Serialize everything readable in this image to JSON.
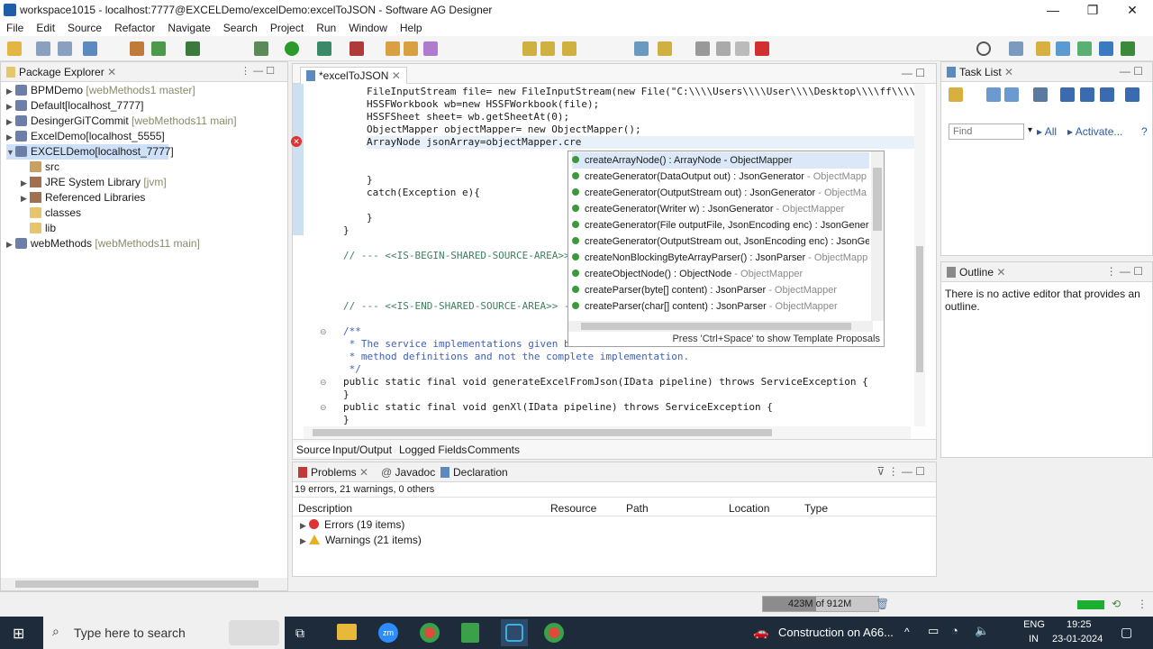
{
  "window": {
    "title": "workspace1015 - localhost:7777@EXCELDemo/excelDemo:excelToJSON - Software AG Designer",
    "min": "—",
    "max": "❐",
    "close": "✕"
  },
  "menu": [
    "File",
    "Edit",
    "Source",
    "Refactor",
    "Navigate",
    "Search",
    "Project",
    "Run",
    "Window",
    "Help"
  ],
  "package_explorer": {
    "tab": "Package Explorer",
    "items": [
      {
        "name": "BPMDemo",
        "extra": "[webMethods1 master]"
      },
      {
        "name": "Default[localhost_7777]",
        "extra": ""
      },
      {
        "name": "DesingerGiTCommit",
        "extra": "[webMethods11 main]"
      },
      {
        "name": "ExcelDemo[localhost_5555]",
        "extra": ""
      },
      {
        "name": "EXCELDemo[localhost_7777]",
        "extra": ""
      },
      {
        "name": "src",
        "extra": ""
      },
      {
        "name": "JRE System Library",
        "extra": "[jvm]"
      },
      {
        "name": "Referenced Libraries",
        "extra": ""
      },
      {
        "name": "classes",
        "extra": ""
      },
      {
        "name": "lib",
        "extra": ""
      },
      {
        "name": "webMethods",
        "extra": "[webMethods11 main]"
      }
    ]
  },
  "editor": {
    "tab": "*excelToJSON",
    "lines": [
      "FileInputStream file= new FileInputStream(new File(\"C:\\\\\\\\Users\\\\\\\\User\\\\\\\\Desktop\\\\\\\\ff\\\\\\\\",
      "HSSFWorkbook wb=new HSSFWorkbook(file);",
      "HSSFSheet sheet= wb.getSheetAt(0);",
      "ObjectMapper objectMapper= new ObjectMapper();",
      "ArrayNode jsonArray=objectMapper.cre",
      "}",
      "catch(Exception e){",
      "}",
      "}",
      "// --- <<IS-BEGIN-SHARED-SOURCE-AREA>> ---",
      "// --- <<IS-END-SHARED-SOURCE-AREA>> ---",
      "/**",
      " * The service implementations given b",
      " * method definitions and not the complete implementation.",
      " */",
      "public static final void generateExcelFromJson(IData pipeline) throws ServiceException {",
      "}",
      "public static final void genXl(IData pipeline) throws ServiceException {",
      "}"
    ],
    "bottom_tabs": [
      "Source",
      "Input/Output",
      "Logged Fields",
      "Comments"
    ]
  },
  "autocomplete": {
    "items": [
      {
        "sig": "createArrayNode() : ArrayNode",
        "owner": " - ObjectMapper"
      },
      {
        "sig": "createGenerator(DataOutput out) : JsonGenerator",
        "owner": " - ObjectMapp"
      },
      {
        "sig": "createGenerator(OutputStream out) : JsonGenerator",
        "owner": " - ObjectMa"
      },
      {
        "sig": "createGenerator(Writer w) : JsonGenerator",
        "owner": " - ObjectMapper"
      },
      {
        "sig": "createGenerator(File outputFile, JsonEncoding enc) : JsonGenera",
        "owner": ""
      },
      {
        "sig": "createGenerator(OutputStream out, JsonEncoding enc) : JsonGe",
        "owner": ""
      },
      {
        "sig": "createNonBlockingByteArrayParser() : JsonParser",
        "owner": " - ObjectMapp"
      },
      {
        "sig": "createObjectNode() : ObjectNode",
        "owner": " - ObjectMapper"
      },
      {
        "sig": "createParser(byte[] content) : JsonParser",
        "owner": " - ObjectMapper"
      },
      {
        "sig": "createParser(char[] content) : JsonParser",
        "owner": " - ObjectMapper"
      }
    ],
    "hint": "Press 'Ctrl+Space' to show Template Proposals"
  },
  "task_list": {
    "tab": "Task List",
    "find_placeholder": "Find",
    "all": "All",
    "activate": "Activate..."
  },
  "outline": {
    "tab": "Outline",
    "message": "There is no active editor that provides an outline."
  },
  "problems": {
    "tabs": [
      "Problems",
      "Javadoc",
      "Declaration"
    ],
    "summary": "19 errors, 21 warnings, 0 others",
    "columns": [
      "Description",
      "Resource",
      "Path",
      "Location",
      "Type"
    ],
    "rows": [
      "Errors (19 items)",
      "Warnings (21 items)"
    ]
  },
  "status": {
    "memory": "423M of 912M"
  },
  "taskbar": {
    "search_placeholder": "Type here to search",
    "notification": "Construction on A66...",
    "lang1": "ENG",
    "lang2": "IN",
    "time": "19:25",
    "date": "23-01-2024"
  }
}
